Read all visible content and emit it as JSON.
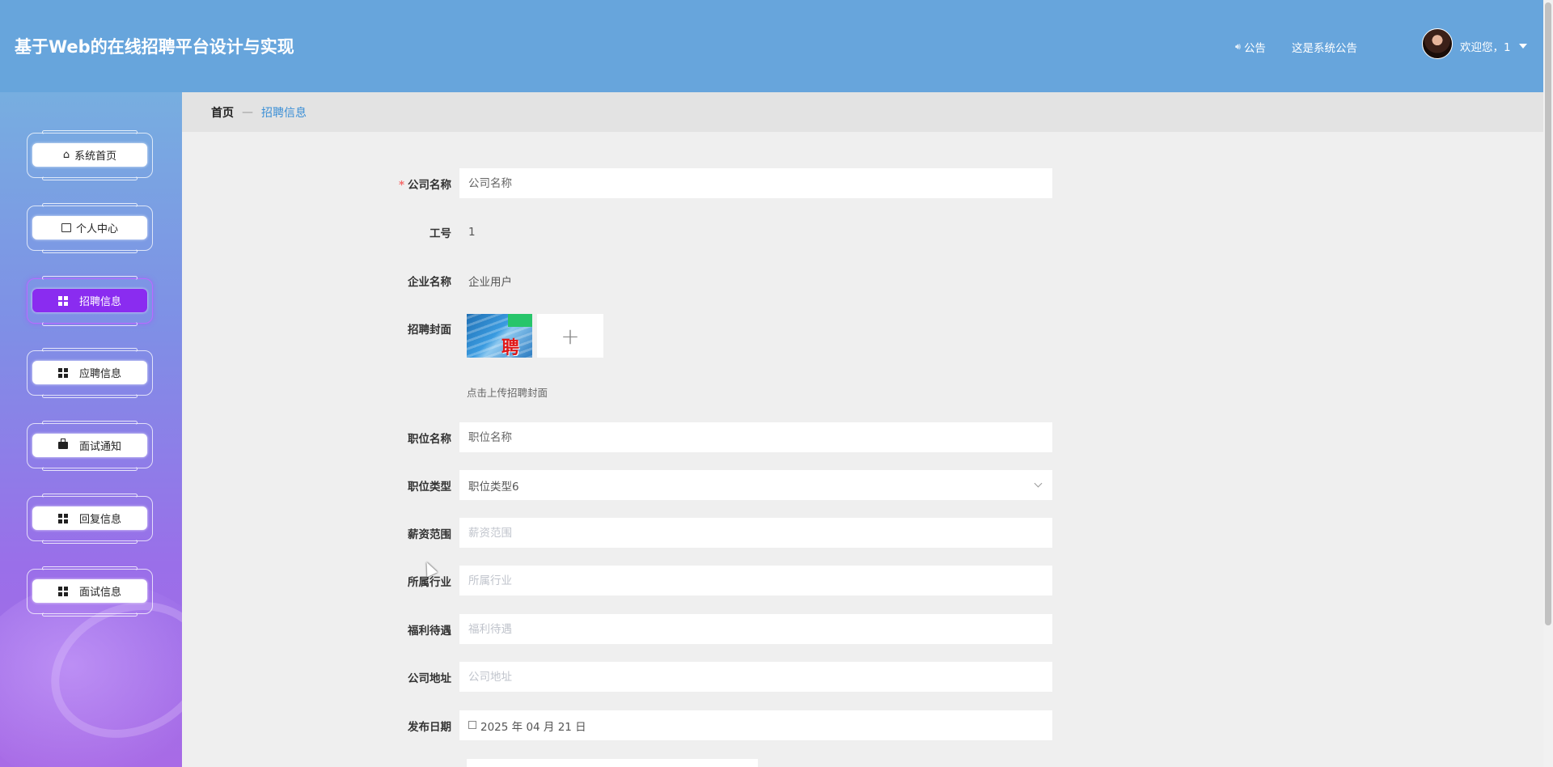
{
  "header": {
    "title": "基于Web的在线招聘平台设计与实现",
    "notice_label": "公告",
    "notice_text": "这是系统公告",
    "welcome": "欢迎您，1"
  },
  "sidebar": {
    "items": [
      {
        "label": "系统首页",
        "icon": "home-icon",
        "active": false
      },
      {
        "label": "个人中心",
        "icon": "wallet-icon",
        "active": false
      },
      {
        "label": "招聘信息",
        "icon": "grid-icon",
        "active": true
      },
      {
        "label": "应聘信息",
        "icon": "grid-icon",
        "active": false
      },
      {
        "label": "面试通知",
        "icon": "briefcase-icon",
        "active": false
      },
      {
        "label": "回复信息",
        "icon": "grid-icon",
        "active": false
      },
      {
        "label": "面试信息",
        "icon": "grid-icon",
        "active": false
      }
    ]
  },
  "breadcrumb": {
    "home": "首页",
    "separator": "—",
    "current": "招聘信息"
  },
  "form": {
    "company_name": {
      "label": "公司名称",
      "required": "*",
      "value": "",
      "placeholder": "公司名称"
    },
    "employee_id": {
      "label": "工号",
      "value": "1"
    },
    "enterprise_name": {
      "label": "企业名称",
      "value": "企业用户"
    },
    "cover": {
      "label": "招聘封面",
      "upload_hint": "点击上传招聘封面",
      "thumb_text": "聘",
      "add_symbol": "+"
    },
    "position_name": {
      "label": "职位名称",
      "value": "",
      "placeholder": "职位名称"
    },
    "position_type": {
      "label": "职位类型",
      "value": "职位类型6"
    },
    "salary_range": {
      "label": "薪资范围",
      "value": "",
      "placeholder": "薪资范围"
    },
    "industry": {
      "label": "所属行业",
      "value": "",
      "placeholder": "所属行业"
    },
    "benefits": {
      "label": "福利待遇",
      "value": "",
      "placeholder": "福利待遇"
    },
    "company_address": {
      "label": "公司地址",
      "value": "",
      "placeholder": "公司地址"
    },
    "publish_date": {
      "label": "发布日期",
      "value": "2025 年 04 月 21 日"
    }
  },
  "colors": {
    "header_bg": "#67a5dc",
    "active_menu": "#8a2cf0",
    "breadcrumb_current": "#3b8fd6",
    "required": "#f56c6c"
  }
}
